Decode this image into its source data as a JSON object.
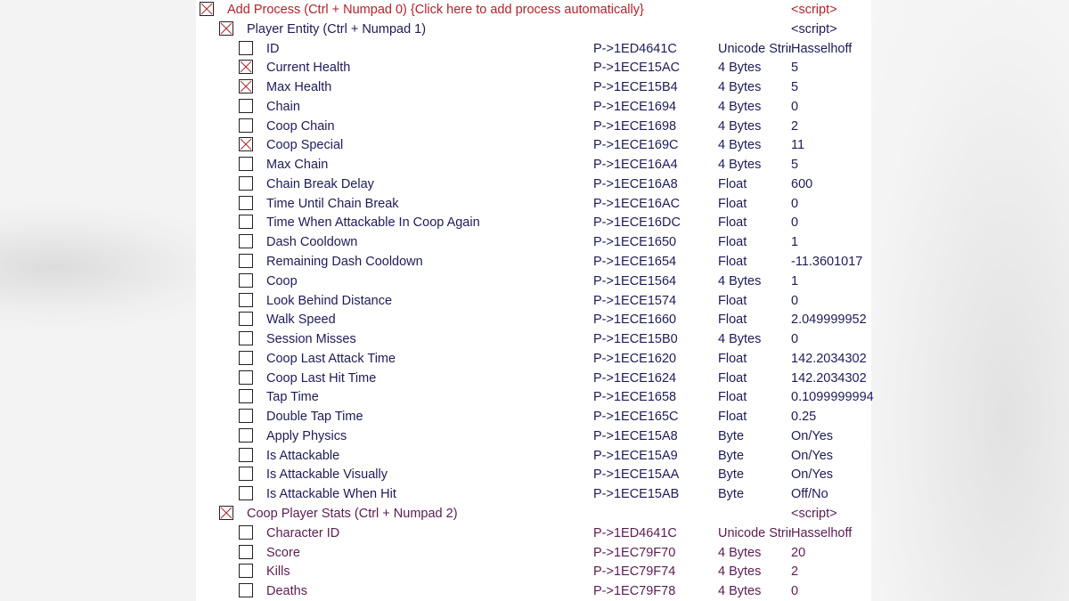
{
  "colors": {
    "process": "#b3222c",
    "player": "#1c1c58",
    "coop": "#5c1c52",
    "cross": "#b3222c"
  },
  "rows": [
    {
      "level": 0,
      "checked": true,
      "group": "process",
      "description": "Add Process (Ctrl + Numpad 0) {Click here to add process automatically}",
      "address": "",
      "type": "",
      "value": "<script>"
    },
    {
      "level": 1,
      "checked": true,
      "group": "player",
      "description": "Player Entity (Ctrl + Numpad 1)",
      "address": "",
      "type": "",
      "value": "<script>"
    },
    {
      "level": 2,
      "checked": false,
      "group": "player",
      "description": "ID",
      "address": "P->1ED4641C",
      "type": "Unicode String",
      "value": "Hasselhoff"
    },
    {
      "level": 2,
      "checked": true,
      "group": "player",
      "description": "Current Health",
      "address": "P->1ECE15AC",
      "type": "4 Bytes",
      "value": "5"
    },
    {
      "level": 2,
      "checked": true,
      "group": "player",
      "description": "Max Health",
      "address": "P->1ECE15B4",
      "type": "4 Bytes",
      "value": "5"
    },
    {
      "level": 2,
      "checked": false,
      "group": "player",
      "description": "Chain",
      "address": "P->1ECE1694",
      "type": "4 Bytes",
      "value": "0"
    },
    {
      "level": 2,
      "checked": false,
      "group": "player",
      "description": "Coop Chain",
      "address": "P->1ECE1698",
      "type": "4 Bytes",
      "value": "2"
    },
    {
      "level": 2,
      "checked": true,
      "group": "player",
      "description": "Coop Special",
      "address": "P->1ECE169C",
      "type": "4 Bytes",
      "value": "11"
    },
    {
      "level": 2,
      "checked": false,
      "group": "player",
      "description": "Max Chain",
      "address": "P->1ECE16A4",
      "type": "4 Bytes",
      "value": "5"
    },
    {
      "level": 2,
      "checked": false,
      "group": "player",
      "description": "Chain Break Delay",
      "address": "P->1ECE16A8",
      "type": "Float",
      "value": "600"
    },
    {
      "level": 2,
      "checked": false,
      "group": "player",
      "description": "Time Until Chain Break",
      "address": "P->1ECE16AC",
      "type": "Float",
      "value": "0"
    },
    {
      "level": 2,
      "checked": false,
      "group": "player",
      "description": "Time When Attackable In Coop Again",
      "address": "P->1ECE16DC",
      "type": "Float",
      "value": "0"
    },
    {
      "level": 2,
      "checked": false,
      "group": "player",
      "description": "Dash Cooldown",
      "address": "P->1ECE1650",
      "type": "Float",
      "value": "1"
    },
    {
      "level": 2,
      "checked": false,
      "group": "player",
      "description": "Remaining Dash Cooldown",
      "address": "P->1ECE1654",
      "type": "Float",
      "value": "-11.3601017"
    },
    {
      "level": 2,
      "checked": false,
      "group": "player",
      "description": "Coop",
      "address": "P->1ECE1564",
      "type": "4 Bytes",
      "value": "1"
    },
    {
      "level": 2,
      "checked": false,
      "group": "player",
      "description": "Look Behind Distance",
      "address": "P->1ECE1574",
      "type": "Float",
      "value": "0"
    },
    {
      "level": 2,
      "checked": false,
      "group": "player",
      "description": "Walk Speed",
      "address": "P->1ECE1660",
      "type": "Float",
      "value": "2.049999952"
    },
    {
      "level": 2,
      "checked": false,
      "group": "player",
      "description": "Session Misses",
      "address": "P->1ECE15B0",
      "type": "4 Bytes",
      "value": "0"
    },
    {
      "level": 2,
      "checked": false,
      "group": "player",
      "description": "Coop Last Attack Time",
      "address": "P->1ECE1620",
      "type": "Float",
      "value": "142.2034302"
    },
    {
      "level": 2,
      "checked": false,
      "group": "player",
      "description": "Coop Last Hit Time",
      "address": "P->1ECE1624",
      "type": "Float",
      "value": "142.2034302"
    },
    {
      "level": 2,
      "checked": false,
      "group": "player",
      "description": "Tap Time",
      "address": "P->1ECE1658",
      "type": "Float",
      "value": "0.1099999994"
    },
    {
      "level": 2,
      "checked": false,
      "group": "player",
      "description": "Double Tap Time",
      "address": "P->1ECE165C",
      "type": "Float",
      "value": "0.25"
    },
    {
      "level": 2,
      "checked": false,
      "group": "player",
      "description": "Apply Physics",
      "address": "P->1ECE15A8",
      "type": "Byte",
      "value": "On/Yes"
    },
    {
      "level": 2,
      "checked": false,
      "group": "player",
      "description": "Is Attackable",
      "address": "P->1ECE15A9",
      "type": "Byte",
      "value": "On/Yes"
    },
    {
      "level": 2,
      "checked": false,
      "group": "player",
      "description": "Is Attackable Visually",
      "address": "P->1ECE15AA",
      "type": "Byte",
      "value": "On/Yes"
    },
    {
      "level": 2,
      "checked": false,
      "group": "player",
      "description": "Is Attackable When Hit",
      "address": "P->1ECE15AB",
      "type": "Byte",
      "value": "Off/No"
    },
    {
      "level": 1,
      "checked": true,
      "group": "coop",
      "description": "Coop Player Stats (Ctrl + Numpad 2)",
      "address": "",
      "type": "",
      "value": "<script>"
    },
    {
      "level": 2,
      "checked": false,
      "group": "coop",
      "description": "Character ID",
      "address": "P->1ED4641C",
      "type": "Unicode String",
      "value": "Hasselhoff"
    },
    {
      "level": 2,
      "checked": false,
      "group": "coop",
      "description": "Score",
      "address": "P->1EC79F70",
      "type": "4 Bytes",
      "value": "20"
    },
    {
      "level": 2,
      "checked": false,
      "group": "coop",
      "description": "Kills",
      "address": "P->1EC79F74",
      "type": "4 Bytes",
      "value": "2"
    },
    {
      "level": 2,
      "checked": false,
      "group": "coop",
      "description": "Deaths",
      "address": "P->1EC79F78",
      "type": "4 Bytes",
      "value": "0"
    }
  ]
}
